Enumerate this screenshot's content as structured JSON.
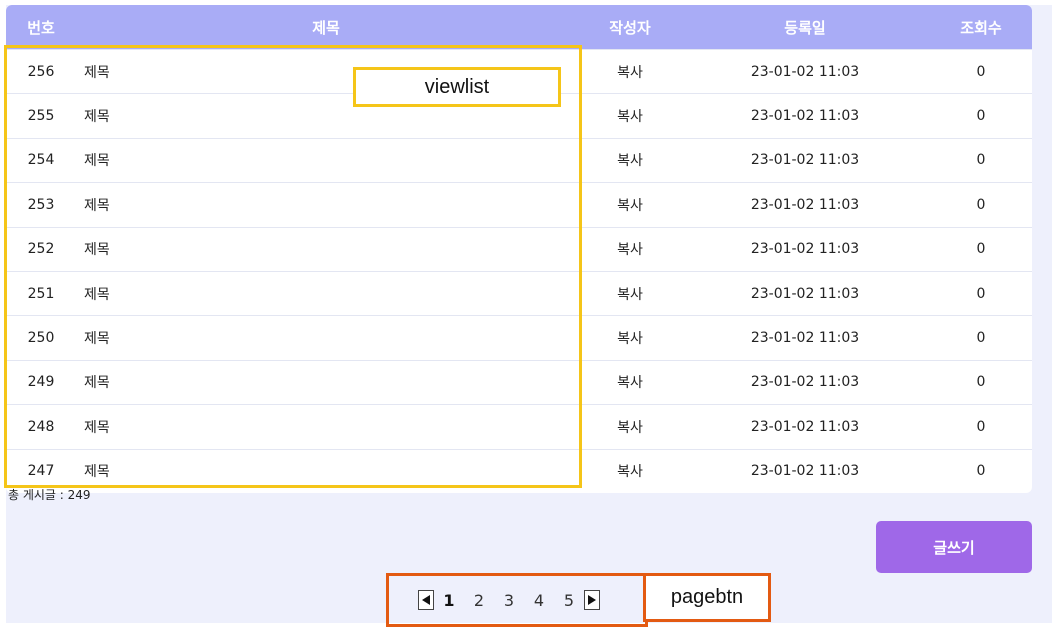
{
  "table": {
    "headers": {
      "num": "번호",
      "title": "제목",
      "writer": "작성자",
      "date": "등록일",
      "views": "조회수"
    },
    "rows": [
      {
        "num": "256",
        "title": "제목",
        "writer": "복사",
        "date": "23-01-02 11:03",
        "views": "0"
      },
      {
        "num": "255",
        "title": "제목",
        "writer": "복사",
        "date": "23-01-02 11:03",
        "views": "0"
      },
      {
        "num": "254",
        "title": "제목",
        "writer": "복사",
        "date": "23-01-02 11:03",
        "views": "0"
      },
      {
        "num": "253",
        "title": "제목",
        "writer": "복사",
        "date": "23-01-02 11:03",
        "views": "0"
      },
      {
        "num": "252",
        "title": "제목",
        "writer": "복사",
        "date": "23-01-02 11:03",
        "views": "0"
      },
      {
        "num": "251",
        "title": "제목",
        "writer": "복사",
        "date": "23-01-02 11:03",
        "views": "0"
      },
      {
        "num": "250",
        "title": "제목",
        "writer": "복사",
        "date": "23-01-02 11:03",
        "views": "0"
      },
      {
        "num": "249",
        "title": "제목",
        "writer": "복사",
        "date": "23-01-02 11:03",
        "views": "0"
      },
      {
        "num": "248",
        "title": "제목",
        "writer": "복사",
        "date": "23-01-02 11:03",
        "views": "0"
      },
      {
        "num": "247",
        "title": "제목",
        "writer": "복사",
        "date": "23-01-02 11:03",
        "views": "0"
      }
    ]
  },
  "total_label": "총 게시글 : 249",
  "write_button": "글쓰기",
  "pagination": {
    "prev_icon": "triangle-left-icon",
    "next_icon": "triangle-right-icon",
    "pages": [
      "1",
      "2",
      "3",
      "4",
      "5"
    ],
    "current": "1"
  },
  "annotations": {
    "viewlist": "viewlist",
    "pagebtn": "pagebtn"
  },
  "colors": {
    "header_bg": "#a9acf6",
    "page_bg": "#eef0fc",
    "button_bg": "#9f68e8",
    "annotation_yellow": "#f5c518",
    "annotation_orange": "#e35a12"
  }
}
